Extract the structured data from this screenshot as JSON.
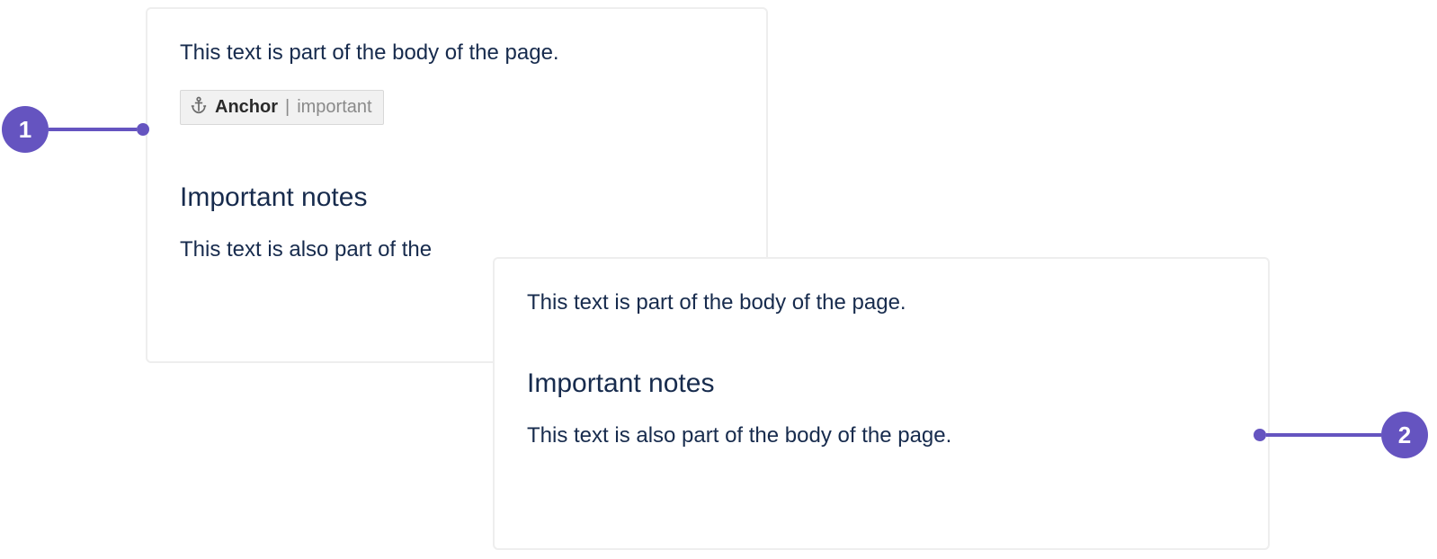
{
  "callouts": {
    "one": "1",
    "two": "2"
  },
  "panel1": {
    "body_top": "This text is part of the body of the page.",
    "anchor": {
      "label": "Anchor",
      "separator": "|",
      "name": "important",
      "icon": "anchor-icon"
    },
    "heading": "Important notes",
    "body_bottom": "This text is also part of the"
  },
  "panel2": {
    "body_top": "This text is part of the body of the page.",
    "heading": "Important notes",
    "body_bottom": "This text is also part of the body of the page."
  }
}
